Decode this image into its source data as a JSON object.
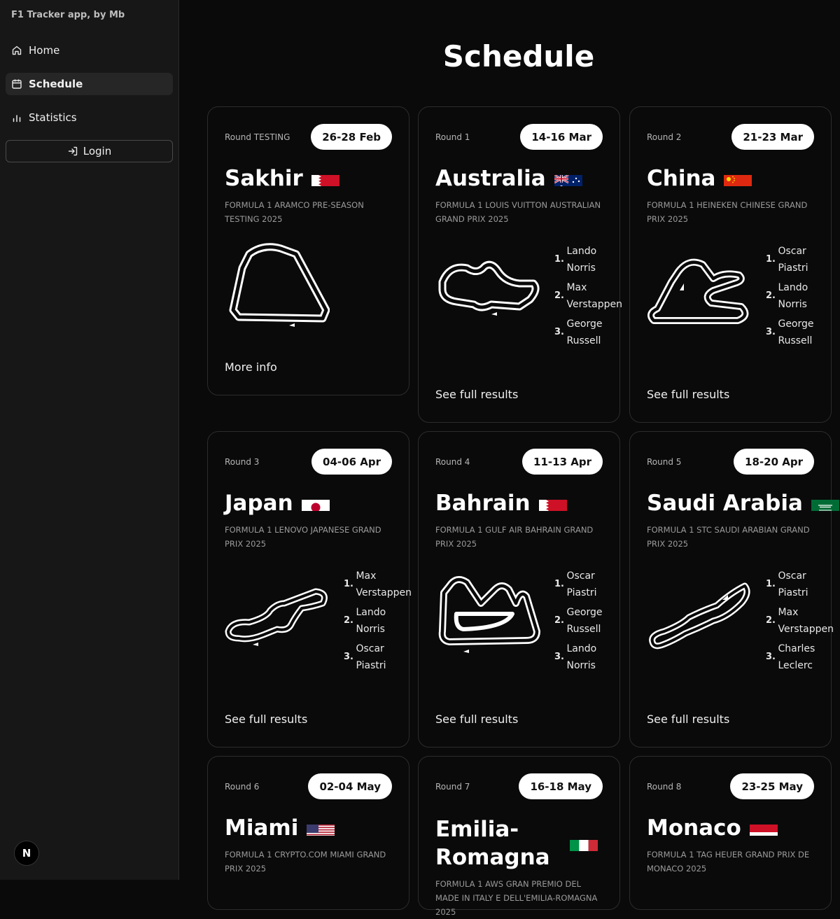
{
  "app": {
    "title": "F1 Tracker app, by Mb"
  },
  "nav": {
    "home": "Home",
    "schedule": "Schedule",
    "statistics": "Statistics",
    "login": "Login"
  },
  "page": {
    "title": "Schedule"
  },
  "badge": {
    "letter": "N"
  },
  "cards": [
    {
      "round": "Round TESTING",
      "date": "26-28 Feb",
      "country": "Sakhir",
      "flag": "bahrain",
      "gp": "FORMULA 1 ARAMCO PRE-SEASON TESTING 2025",
      "link": "More info"
    },
    {
      "round": "Round 1",
      "date": "14-16 Mar",
      "country": "Australia",
      "flag": "australia",
      "gp": "FORMULA 1 LOUIS VUITTON AUSTRALIAN GRAND PRIX 2025",
      "podium": [
        {
          "pos": "1.",
          "name": "Lando Norris"
        },
        {
          "pos": "2.",
          "name": "Max Verstappen"
        },
        {
          "pos": "3.",
          "name": "George Russell"
        }
      ],
      "link": "See full results"
    },
    {
      "round": "Round 2",
      "date": "21-23 Mar",
      "country": "China",
      "flag": "china",
      "gp": "FORMULA 1 HEINEKEN CHINESE GRAND PRIX 2025",
      "podium": [
        {
          "pos": "1.",
          "name": "Oscar Piastri"
        },
        {
          "pos": "2.",
          "name": "Lando Norris"
        },
        {
          "pos": "3.",
          "name": "George Russell"
        }
      ],
      "link": "See full results"
    },
    {
      "round": "Round 3",
      "date": "04-06 Apr",
      "country": "Japan",
      "flag": "japan",
      "gp": "FORMULA 1 LENOVO JAPANESE GRAND PRIX 2025",
      "podium": [
        {
          "pos": "1.",
          "name": "Max Verstappen"
        },
        {
          "pos": "2.",
          "name": "Lando Norris"
        },
        {
          "pos": "3.",
          "name": "Oscar Piastri"
        }
      ],
      "link": "See full results"
    },
    {
      "round": "Round 4",
      "date": "11-13 Apr",
      "country": "Bahrain",
      "flag": "bahrain",
      "gp": "FORMULA 1 GULF AIR BAHRAIN GRAND PRIX 2025",
      "podium": [
        {
          "pos": "1.",
          "name": "Oscar Piastri"
        },
        {
          "pos": "2.",
          "name": "George Russell"
        },
        {
          "pos": "3.",
          "name": "Lando Norris"
        }
      ],
      "link": "See full results"
    },
    {
      "round": "Round 5",
      "date": "18-20 Apr",
      "country": "Saudi Arabia",
      "flag": "saudi-arabia",
      "gp": "FORMULA 1 STC SAUDI ARABIAN GRAND PRIX 2025",
      "podium": [
        {
          "pos": "1.",
          "name": "Oscar Piastri"
        },
        {
          "pos": "2.",
          "name": "Max Verstappen"
        },
        {
          "pos": "3.",
          "name": "Charles Leclerc"
        }
      ],
      "link": "See full results"
    },
    {
      "round": "Round 6",
      "date": "02-04 May",
      "country": "Miami",
      "flag": "usa",
      "gp": "FORMULA 1 CRYPTO.COM MIAMI GRAND PRIX 2025"
    },
    {
      "round": "Round 7",
      "date": "16-18 May",
      "country": "Emilia-Romagna",
      "flag": "italy",
      "gp": "FORMULA 1 AWS GRAN PREMIO DEL MADE IN ITALY E DELL'EMILIA-ROMAGNA 2025"
    },
    {
      "round": "Round 8",
      "date": "23-25 May",
      "country": "Monaco",
      "flag": "monaco",
      "gp": "FORMULA 1 TAG HEUER GRAND PRIX DE MONACO 2025"
    }
  ]
}
